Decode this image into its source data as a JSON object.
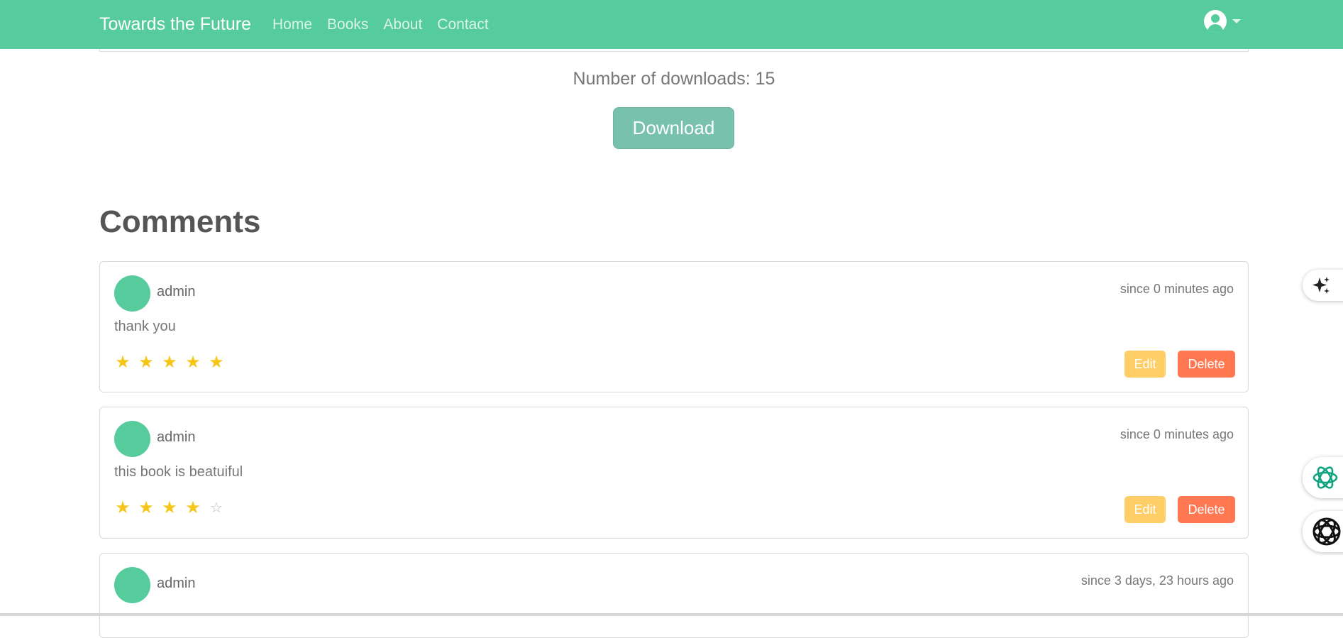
{
  "navbar": {
    "brand": "Towards the Future",
    "links": [
      "Home",
      "Books",
      "About",
      "Contact"
    ]
  },
  "book": {
    "downloads_text": "Number of downloads: 15",
    "download_label": "Download"
  },
  "comments": {
    "title": "Comments",
    "items": [
      {
        "author": "admin",
        "time": "since 0 minutes ago",
        "text": "thank you",
        "rating": 5,
        "edit_label": "Edit",
        "delete_label": "Delete"
      },
      {
        "author": "admin",
        "time": "since 0 minutes ago",
        "text": "this book is beatuiful",
        "rating": 4,
        "edit_label": "Edit",
        "delete_label": "Delete"
      },
      {
        "author": "admin",
        "time": "since 3 days, 23 hours ago",
        "text": "",
        "rating": null
      }
    ]
  },
  "icons": [
    "user-circle-icon",
    "caret-down-icon",
    "sparkle-icon",
    "chatgpt-icon",
    "ai-assistant-icon",
    "star-icon"
  ],
  "colors": {
    "primary": "#56cc9d",
    "secondary": "#78c2ad",
    "warning": "#ffce67",
    "danger": "#ff7851",
    "star": "#f5c518"
  }
}
